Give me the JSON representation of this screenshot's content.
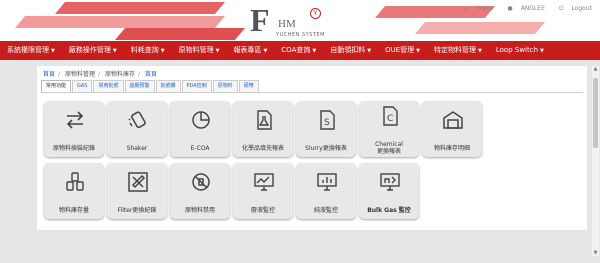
{
  "brand": {
    "logo_letter": "F",
    "logo_sub": "HM",
    "logo_badge": "Y",
    "system_name": "YUCHEN SYSTEM"
  },
  "toplinks": {
    "home": "Home",
    "user": "ANGLEE",
    "logout": "Logout"
  },
  "nav": [
    {
      "label": "系統權限管理"
    },
    {
      "label": "廠務操作管理"
    },
    {
      "label": "料耗查詢"
    },
    {
      "label": "原物料管理"
    },
    {
      "label": "報表專區"
    },
    {
      "label": "COA查詢"
    },
    {
      "label": "自動領扣料"
    },
    {
      "label": "OUE管理"
    },
    {
      "label": "特定物料管理"
    },
    {
      "label": "Loop Switch"
    }
  ],
  "breadcrumb": [
    "首頁",
    "原物料管理",
    "原物料庫存",
    "首頁"
  ],
  "tabs": [
    "常用功能",
    "GAS",
    "常用批號",
    "過期預警",
    "批號欄",
    "PDA控制",
    "原物料",
    "硬幣"
  ],
  "tiles": [
    {
      "label": "原物料換裝紀錄",
      "icon": "swap-icon"
    },
    {
      "label": "Shaker",
      "icon": "shaker-icon"
    },
    {
      "label": "E-COA",
      "icon": "pie-chart-icon"
    },
    {
      "label": "化學品填充報表",
      "icon": "flask-document-icon"
    },
    {
      "label": "Slurry更換報表",
      "icon": "slurry-document-icon"
    },
    {
      "label": "Chemical",
      "label2": "更換報表",
      "icon": "chemical-document-icon"
    },
    {
      "label": "物料庫存明細",
      "icon": "warehouse-icon"
    },
    {
      "label": "物料庫存量",
      "icon": "barrels-icon"
    },
    {
      "label": "Filter更換紀錄",
      "icon": "tools-icon"
    },
    {
      "label": "原物料禁用",
      "icon": "ban-icon"
    },
    {
      "label": "廢液監控",
      "icon": "monitor-chart-icon"
    },
    {
      "label": "純液監控",
      "icon": "monitor-bar-icon"
    },
    {
      "label": "Bulk Gas 監控",
      "icon": "monitor-gas-icon"
    }
  ],
  "colors": {
    "nav": "#c81d1d",
    "accent": "#1a66c8"
  }
}
